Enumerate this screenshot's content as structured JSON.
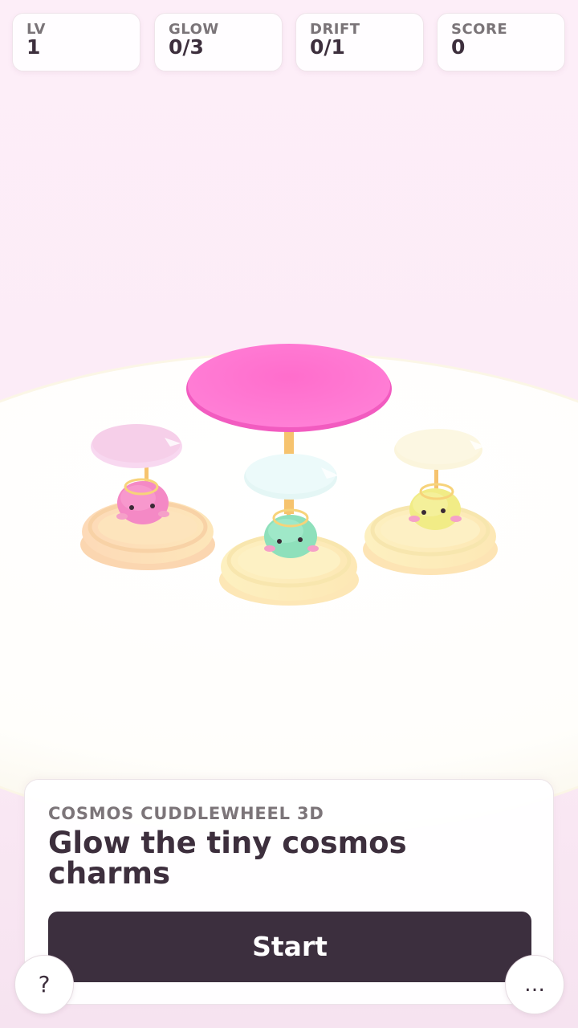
{
  "hud": {
    "level": {
      "label": "LV",
      "value": "1"
    },
    "glow": {
      "label": "GLOW",
      "value": "0/3"
    },
    "drift": {
      "label": "DRIFT",
      "value": "0/1"
    },
    "score": {
      "label": "SCORE",
      "value": "0"
    }
  },
  "panel": {
    "kicker": "COSMOS CUDDLEWHEEL 3D",
    "headline": "Glow the tiny cosmos charms",
    "start_label": "Start"
  },
  "buttons": {
    "help_label": "?",
    "more_label": "…"
  },
  "charms": [
    {
      "name": "pink-charm",
      "body_color": "#f48cc6",
      "canopy_color": "#f6d6ee"
    },
    {
      "name": "mint-charm",
      "body_color": "#8fe0bd",
      "canopy_color": "#e4f8f6"
    },
    {
      "name": "yellow-charm",
      "body_color": "#f3ee8c",
      "canopy_color": "#fbf6d8"
    }
  ],
  "colors": {
    "main_canopy": "#ff72cf",
    "base": "#fde9b8",
    "button_dark": "#3c2f3e",
    "text_dark": "#3d2f3d"
  }
}
